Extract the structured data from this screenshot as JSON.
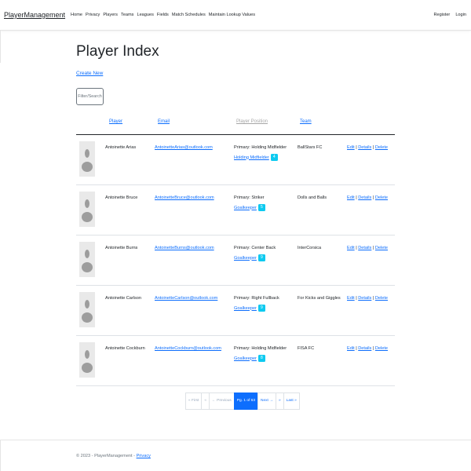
{
  "nav": {
    "brand": "PlayerManagement",
    "links": [
      "Home",
      "Privacy",
      "Players",
      "Teams",
      "Leagues",
      "Fields",
      "Match Schedules",
      "Maintain Lookup Values"
    ],
    "right": [
      "Register",
      "Login"
    ]
  },
  "page": {
    "title": "Player Index",
    "create_new": "Create New",
    "filter_button": "Filter/Search"
  },
  "table": {
    "headers": [
      "Player",
      "Email",
      "Player Position",
      "Team"
    ],
    "rows": [
      {
        "name": "Antoinette Arias",
        "email": "AntoinetteArias@outlook.com",
        "primary": "Primary: Holding Midfielder",
        "secondary": "Holding Midfielder",
        "badge": "4",
        "team": "BallStars FC"
      },
      {
        "name": "Antoinette Bruce",
        "email": "AntoinetteBruce@outlook.com",
        "primary": "Primary: Striker",
        "secondary": "Goalkeeper",
        "badge": "5",
        "team": "Dolls and Balls"
      },
      {
        "name": "Antoinette Burns",
        "email": "AntoinetteBurns@outlook.com",
        "primary": "Primary: Center Back",
        "secondary": "Goalkeeper",
        "badge": "9",
        "team": "InterCorsica"
      },
      {
        "name": "Antoinette Carlson",
        "email": "AntoinetteCarlson@outlook.com",
        "primary": "Primary: Right Fullback",
        "secondary": "Goalkeeper",
        "badge": "9",
        "team": "For Kicks and Giggles"
      },
      {
        "name": "Antoinette Cockburn",
        "email": "AntoinetteCockburn@outlook.com",
        "primary": "Primary: Holding Midfielder",
        "secondary": "Goalkeeper",
        "badge": "8",
        "team": "FISA FC"
      }
    ],
    "actions": {
      "edit": "Edit",
      "details": "Details",
      "delete": "Delete",
      "sep": " | "
    }
  },
  "pagination": {
    "first": "« First",
    "prev_arrow": "«",
    "previous": "← Previous",
    "current": "Pg. 1 of 63",
    "next": "Next →",
    "next_arrow": "»",
    "last": "Last »"
  },
  "footer": {
    "text": "© 2023 - PlayerManagement - ",
    "privacy": "Privacy"
  },
  "colors": {
    "link": "#0d6efd",
    "badge": "#0dcaf0",
    "active_page": "#0d6efd"
  }
}
